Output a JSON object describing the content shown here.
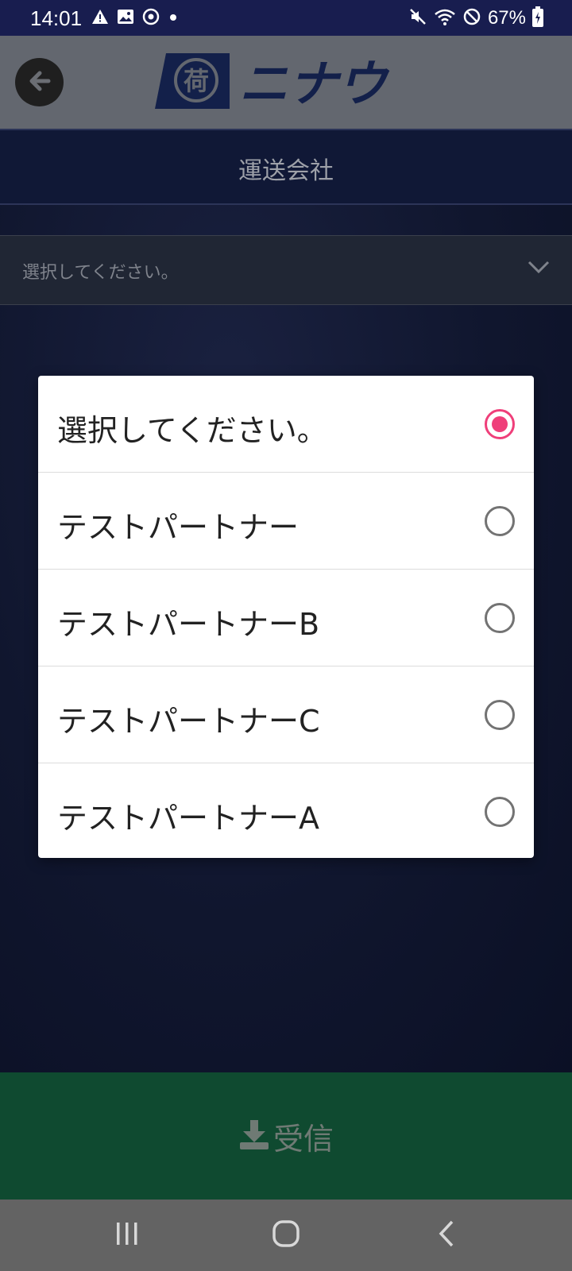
{
  "status_bar": {
    "time": "14:01",
    "left_icons": [
      "warning-icon",
      "image-icon",
      "sync-icon",
      "dot-icon"
    ],
    "right_icons": [
      "mute-icon",
      "wifi-icon",
      "dnd-icon",
      "battery-charging-icon"
    ],
    "battery": "67%"
  },
  "app_bar": {
    "back_icon": "back-arrow-icon",
    "logo_mark": "荷",
    "logo_text": "ニナウ"
  },
  "page": {
    "section_title": "運送会社",
    "dropdown_placeholder": "選択してください。",
    "dropdown_icon": "chevron-down-icon"
  },
  "dialog": {
    "options": [
      {
        "label": "選択してください。",
        "selected": true
      },
      {
        "label": "テストパートナー",
        "selected": false
      },
      {
        "label": "テストパートナーB",
        "selected": false
      },
      {
        "label": "テストパートナーC",
        "selected": false
      },
      {
        "label": "テストパートナーA",
        "selected": false
      }
    ]
  },
  "bottom_action": {
    "icon": "download-icon",
    "label": "受信"
  },
  "nav_bar": {
    "buttons": [
      "recent-apps-icon",
      "home-icon",
      "back-icon"
    ]
  },
  "colors": {
    "status_bar": "#181d4f",
    "radio_selected": "#ef3f7a",
    "receive_bar": "#0f4a30"
  }
}
